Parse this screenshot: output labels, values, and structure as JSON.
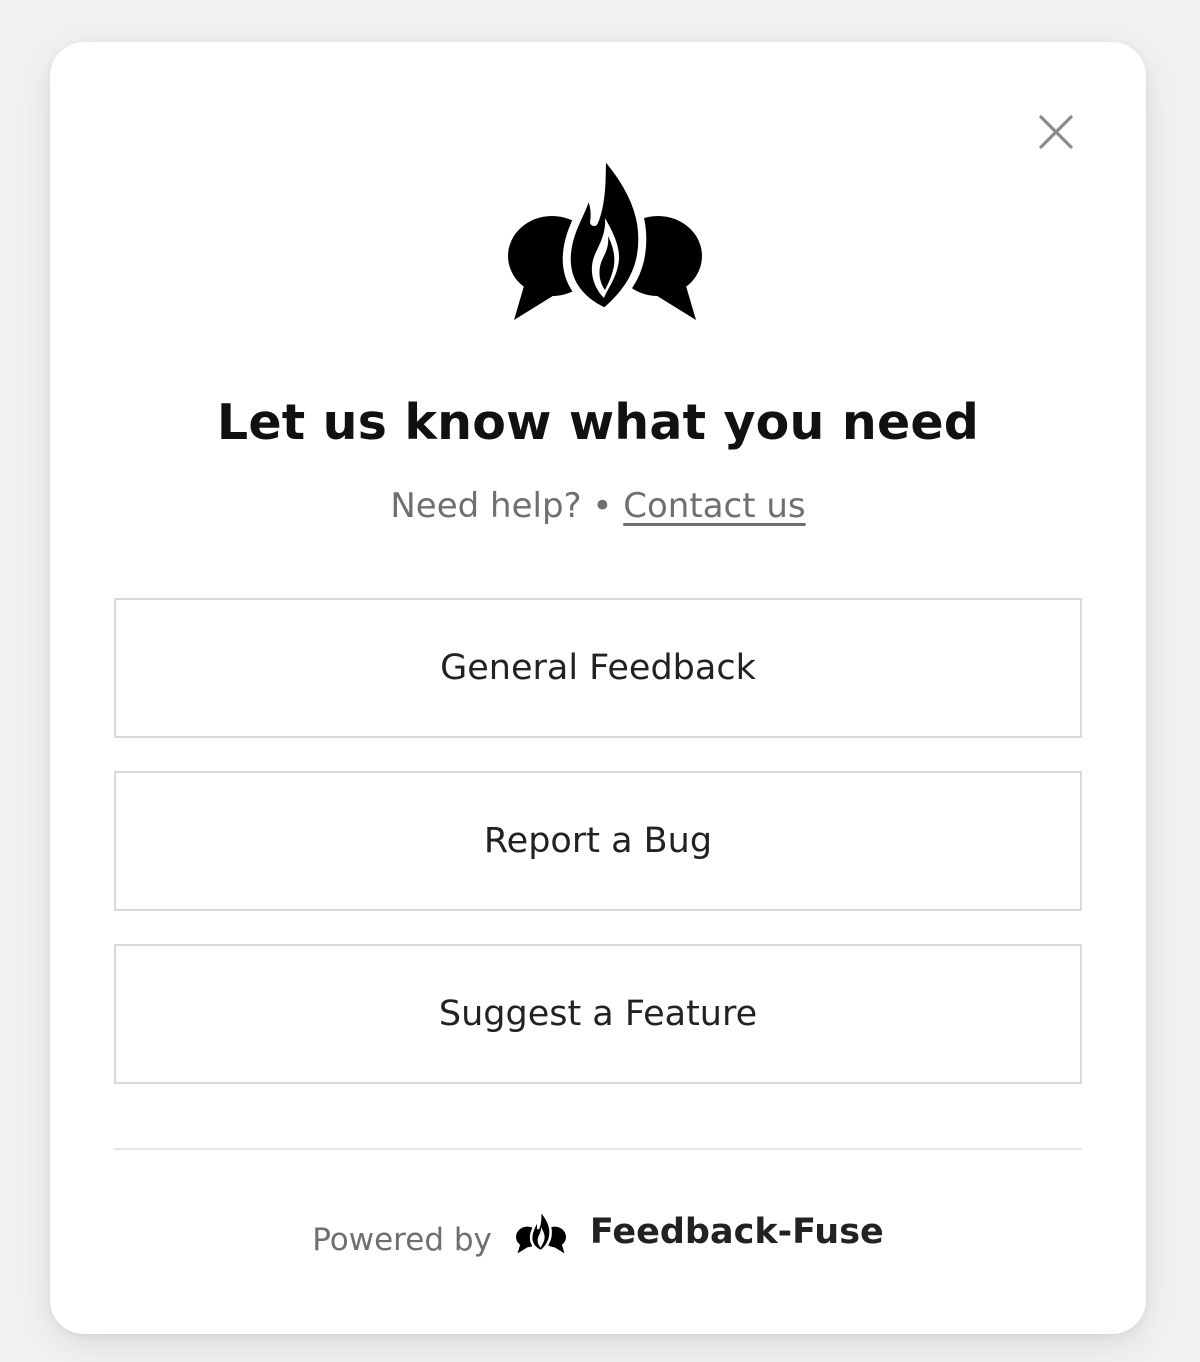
{
  "dialog": {
    "title": "Let us know what you need",
    "help_text": "Need help?",
    "separator": "•",
    "contact_link": "Contact us",
    "close_icon": "close-icon",
    "logo_icon": "flame-chat-bubbles-logo"
  },
  "options": [
    {
      "label": "General Feedback"
    },
    {
      "label": "Report a Bug"
    },
    {
      "label": "Suggest a Feature"
    }
  ],
  "footer": {
    "powered_by": "Powered by",
    "brand": "Feedback-Fuse"
  }
}
